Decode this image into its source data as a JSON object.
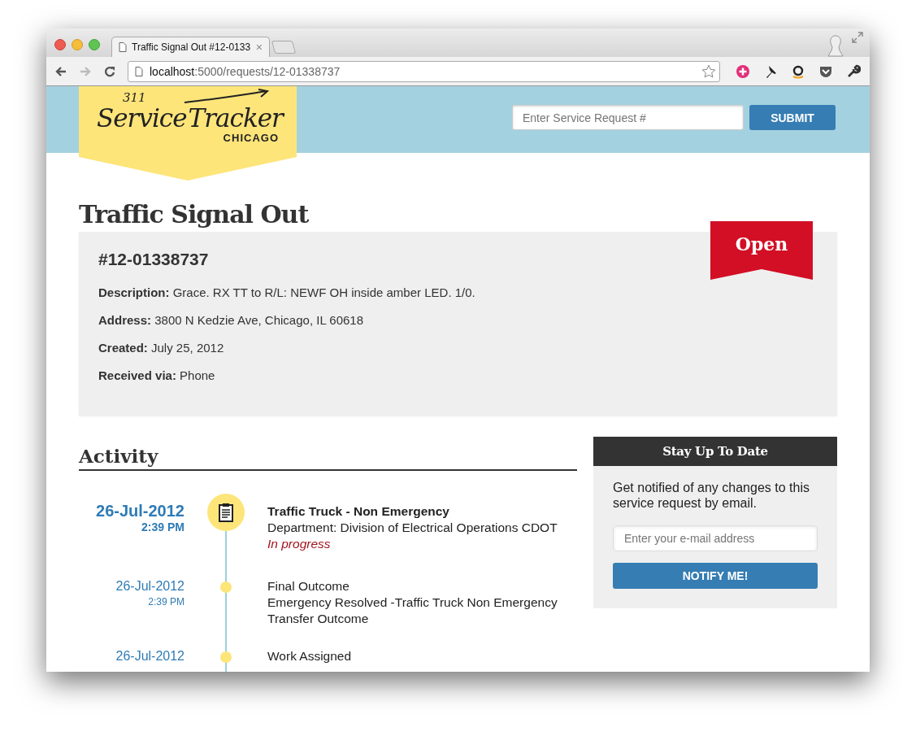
{
  "browser": {
    "tab_title": "Traffic Signal Out #12-0133",
    "tab_close": "×",
    "url_host": "localhost",
    "url_path": ":5000/requests/12-01338737"
  },
  "header": {
    "logo": {
      "number": "311",
      "word_1": "Service",
      "word_2": "Tracker",
      "city": "CHICAGO"
    },
    "search": {
      "placeholder": "Enter Service Request #"
    },
    "submit": "SUBMIT"
  },
  "request": {
    "title": "Traffic Signal Out",
    "number": "#12-01338737",
    "status": "Open",
    "fields": [
      {
        "label": "Description:",
        "value": "Grace. RX TT to R/L: NEWF OH inside amber LED. 1/0."
      },
      {
        "label": "Address:",
        "value": "3800 N Kedzie Ave, Chicago, IL 60618"
      },
      {
        "label": "Created:",
        "value": "July 25, 2012"
      },
      {
        "label": "Received via:",
        "value": "Phone"
      }
    ]
  },
  "activity": {
    "heading": "Activity",
    "items": [
      {
        "kind": "major",
        "date": "26-Jul-2012",
        "time": "2:39 PM",
        "lines": [
          "Traffic Truck - Non Emergency",
          "Department: Division of Electrical Operations CDOT"
        ],
        "status": "In progress"
      },
      {
        "kind": "minor",
        "date": "26-Jul-2012",
        "time": "2:39 PM",
        "lines": [
          "Final Outcome",
          "Emergency Resolved -Traffic Truck Non Emergency",
          "Transfer Outcome"
        ]
      },
      {
        "kind": "minor",
        "date": "26-Jul-2012",
        "lines": [
          "Work Assigned"
        ]
      }
    ]
  },
  "subscribe": {
    "heading": "Stay Up To Date",
    "text": "Get notified of any changes to this service request by email.",
    "placeholder": "Enter your e-mail address",
    "button": "NOTIFY ME!"
  }
}
